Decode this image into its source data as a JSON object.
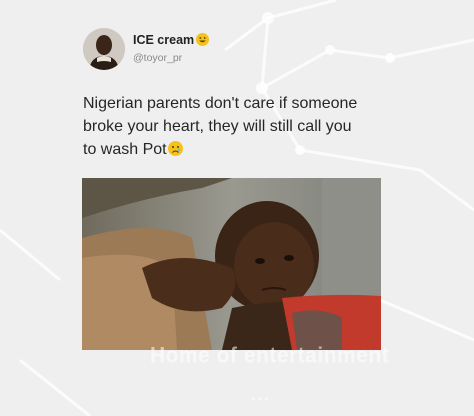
{
  "user": {
    "name": "ICE cream",
    "handle": "@toyor_pr",
    "name_emoji": "grinning-face-icon"
  },
  "tweet": {
    "line1": "Nigerian parents don't care if someone",
    "line2": "broke your heart, they will still call you",
    "line3": "to wash Pot",
    "end_emoji": "sad-face-icon"
  },
  "watermark": {
    "text": "Home of entertainment",
    "text2": "…"
  },
  "colors": {
    "background": "#efefef",
    "text": "#262626",
    "handle": "#8a8a8a",
    "emoji": "#f4c21a"
  }
}
